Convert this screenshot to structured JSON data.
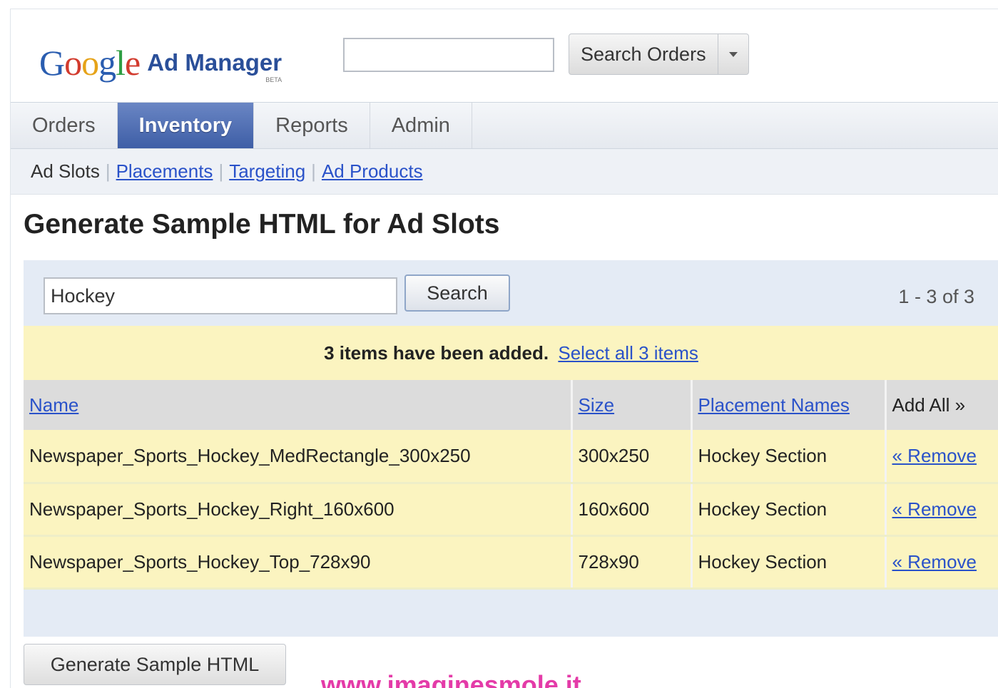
{
  "header": {
    "logo_google": "Google",
    "logo_product": "Ad Manager",
    "logo_beta": "BETA",
    "search_value": "",
    "search_orders_label": "Search Orders"
  },
  "tabs": [
    {
      "label": "Orders",
      "active": false
    },
    {
      "label": "Inventory",
      "active": true
    },
    {
      "label": "Reports",
      "active": false
    },
    {
      "label": "Admin",
      "active": false
    }
  ],
  "subnav": {
    "current": "Ad Slots",
    "links": [
      "Placements",
      "Targeting",
      "Ad Products"
    ]
  },
  "page_title": "Generate Sample HTML for Ad Slots",
  "panel": {
    "search_value": "Hockey",
    "search_button": "Search",
    "pager": "1 - 3 of 3",
    "notice_text": "3 items have been added.",
    "notice_link": "Select all 3 items"
  },
  "table": {
    "headers": [
      "Name",
      "Size",
      "Placement Names",
      "Add All »"
    ],
    "rows": [
      {
        "name": "Newspaper_Sports_Hockey_MedRectangle_300x250",
        "size": "300x250",
        "placement": "Hockey Section",
        "action": "« Remove"
      },
      {
        "name": "Newspaper_Sports_Hockey_Right_160x600",
        "size": "160x600",
        "placement": "Hockey Section",
        "action": "« Remove"
      },
      {
        "name": "Newspaper_Sports_Hockey_Top_728x90",
        "size": "728x90",
        "placement": "Hockey Section",
        "action": "« Remove"
      }
    ]
  },
  "generate_button": "Generate Sample HTML",
  "watermark": "www.imaginesmole.it",
  "colors": {
    "tab_active": "#4a68ae",
    "link": "#2a52c9",
    "notice_bg": "#fbf4c0",
    "panel_bg": "#e4ebf5",
    "watermark": "#e43ba8"
  }
}
